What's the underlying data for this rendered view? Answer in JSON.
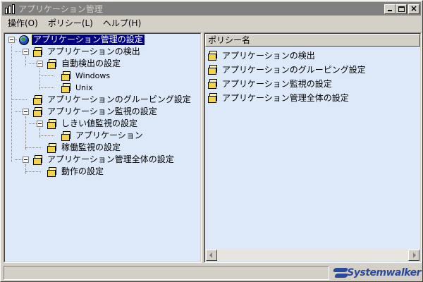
{
  "window": {
    "title": "アプリケーション管理"
  },
  "menu": {
    "items": [
      {
        "label": "操作(O)"
      },
      {
        "label": "ポリシー(L)"
      },
      {
        "label": "ヘルプ(H)"
      }
    ]
  },
  "tree": {
    "root": "アプリケーション管理の設定",
    "detect": "アプリケーションの検出",
    "auto_detect": "自動検出の設定",
    "windows": "Windows",
    "unix": "Unix",
    "grouping": "アプリケーションのグルーピング設定",
    "monitor": "アプリケーション監視の設定",
    "threshold": "しきい値監視の設定",
    "application": "アプリケーション",
    "uptime": "稼働監視の設定",
    "overall": "アプリケーション管理全体の設定",
    "behavior": "動作の設定"
  },
  "list": {
    "column_header": "ポリシー名",
    "rows": [
      {
        "label": "アプリケーションの検出"
      },
      {
        "label": "アプリケーションのグルーピング設定"
      },
      {
        "label": "アプリケーション監視の設定"
      },
      {
        "label": "アプリケーション管理全体の設定"
      }
    ]
  },
  "status": {
    "text": "",
    "brand": "Systemwalker"
  },
  "colors": {
    "pane_background": "#dde9f9",
    "selection": "#000080",
    "folder": "#f2d34c",
    "brand": "#2c4a9a"
  },
  "icons": {
    "folder": "folder-icon",
    "globe": "globe-icon"
  }
}
